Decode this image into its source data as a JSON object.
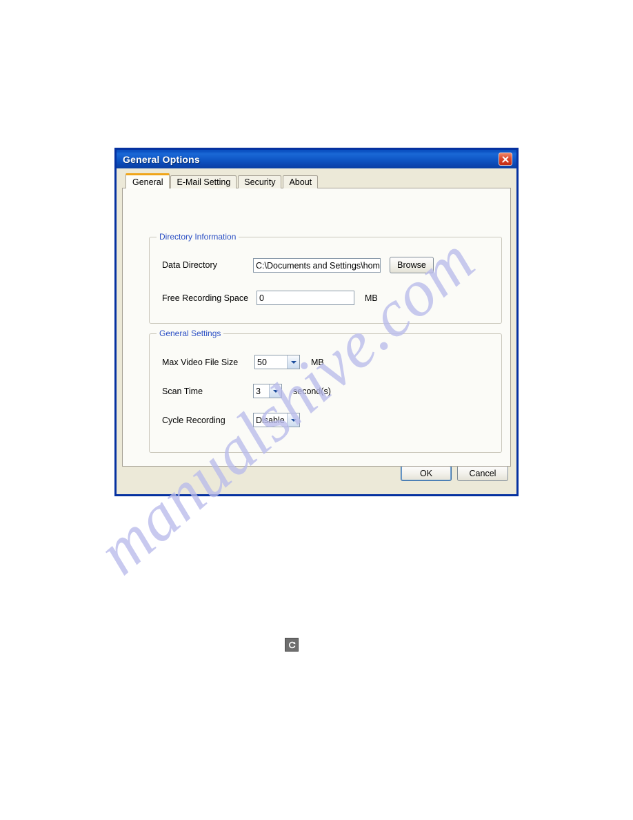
{
  "dialog": {
    "title": "General Options",
    "close_icon": "close-icon",
    "tabs": [
      {
        "label": "General",
        "selected": true
      },
      {
        "label": "E-Mail Setting",
        "selected": false
      },
      {
        "label": "Security",
        "selected": false
      },
      {
        "label": "About",
        "selected": false
      }
    ],
    "groups": {
      "directory": {
        "title": "Directory Information",
        "data_directory": {
          "label": "Data Directory",
          "value": "C:\\Documents and Settings\\home u:",
          "browse_label": "Browse"
        },
        "free_recording_space": {
          "label": "Free Recording Space",
          "value": "0",
          "unit": "MB"
        }
      },
      "general": {
        "title": "General Settings",
        "max_video_file_size": {
          "label": "Max Video File Size",
          "value": "50",
          "unit": "MB"
        },
        "scan_time": {
          "label": "Scan Time",
          "value": "3",
          "unit": "second(s)"
        },
        "cycle_recording": {
          "label": "Cycle Recording",
          "value": "Disable"
        }
      }
    },
    "footer": {
      "ok_label": "OK",
      "cancel_label": "Cancel"
    },
    "colors": {
      "titlebar_blue": "#0f57c6",
      "frame_blue": "#0531a0",
      "group_title_blue": "#2b4fc4",
      "selected_tab_accent": "#f0a519",
      "close_red": "#c12a13",
      "dialog_face": "#ece9d8"
    }
  },
  "watermark": {
    "text": "manualshive.com",
    "color": "#b9bbeb"
  },
  "page": {
    "bottom_icon": "rotate-icon"
  }
}
